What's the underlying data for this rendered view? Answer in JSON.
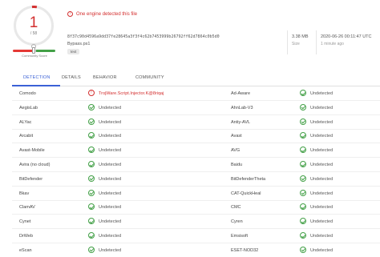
{
  "score": {
    "detections": "1",
    "total": "/ 58"
  },
  "community": {
    "label": "Community Score"
  },
  "header": {
    "detection_notice": "One engine detected this file",
    "warn_glyph": "!"
  },
  "file": {
    "hash": "8f37c90d4596a9dd37fe28645a3f3f4c62b7453999b26792ff62d7864c0b5d0",
    "name": "Bypass.ps1",
    "tag": "text"
  },
  "meta": {
    "size_value": "3.38 MB",
    "size_label": "Size",
    "date_value": "2020-06-26 00:11:47 UTC",
    "date_label": "1 minute ago"
  },
  "tabs": [
    {
      "label": "DETECTION"
    },
    {
      "label": "DETAILS"
    },
    {
      "label": "BEHAVIOR"
    },
    {
      "label": "COMMUNITY"
    }
  ],
  "engines_left": [
    {
      "name": "Comodo",
      "status": "TrojWare.Script.Injector.K@8riqaj",
      "detected": true
    },
    {
      "name": "AegisLab",
      "status": "Undetected",
      "detected": false
    },
    {
      "name": "ALYac",
      "status": "Undetected",
      "detected": false
    },
    {
      "name": "Arcabit",
      "status": "Undetected",
      "detected": false
    },
    {
      "name": "Avast-Mobile",
      "status": "Undetected",
      "detected": false
    },
    {
      "name": "Avira (no cloud)",
      "status": "Undetected",
      "detected": false
    },
    {
      "name": "BitDefender",
      "status": "Undetected",
      "detected": false
    },
    {
      "name": "Bkav",
      "status": "Undetected",
      "detected": false
    },
    {
      "name": "ClamAV",
      "status": "Undetected",
      "detected": false
    },
    {
      "name": "Cynet",
      "status": "Undetected",
      "detected": false
    },
    {
      "name": "DrWeb",
      "status": "Undetected",
      "detected": false
    },
    {
      "name": "eScan",
      "status": "Undetected",
      "detected": false
    }
  ],
  "engines_right": [
    {
      "name": "Ad-Aware",
      "status": "Undetected"
    },
    {
      "name": "AhnLab-V3",
      "status": "Undetected"
    },
    {
      "name": "Antiy-AVL",
      "status": "Undetected"
    },
    {
      "name": "Avast",
      "status": "Undetected"
    },
    {
      "name": "AVG",
      "status": "Undetected"
    },
    {
      "name": "Baidu",
      "status": "Undetected"
    },
    {
      "name": "BitDefenderTheta",
      "status": "Undetected"
    },
    {
      "name": "CAT-QuickHeal",
      "status": "Undetected"
    },
    {
      "name": "CMC",
      "status": "Undetected"
    },
    {
      "name": "Cyren",
      "status": "Undetected"
    },
    {
      "name": "Emsisoft",
      "status": "Undetected"
    },
    {
      "name": "ESET-NOD32",
      "status": "Undetected"
    }
  ],
  "colors": {
    "accent": "#3b61d6",
    "danger": "#d32f2f",
    "ok": "#43a047"
  }
}
